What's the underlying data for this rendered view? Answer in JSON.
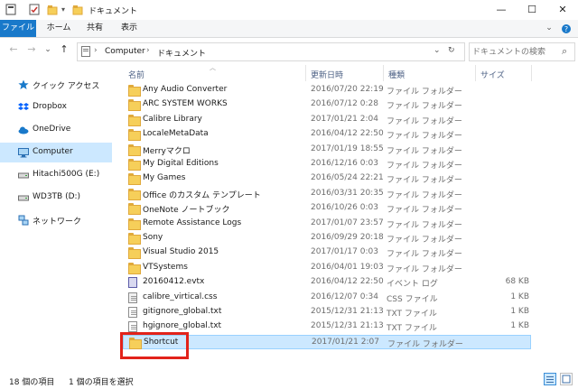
{
  "window": {
    "title": "ドキュメント",
    "minimize_glyph": "—",
    "maximize_glyph": "☐",
    "close_glyph": "✕"
  },
  "ribbon": {
    "tabs": [
      "ファイル",
      "ホーム",
      "共有",
      "表示"
    ],
    "accent": "#1979ca"
  },
  "address": {
    "back_glyph": "←",
    "forward_glyph": "→",
    "recent_glyph": "⌄",
    "up_glyph": "↑",
    "separator": "›",
    "crumbs": [
      "Computer",
      "ドキュメント"
    ],
    "dropdown_glyph": "⌄",
    "refresh_glyph": "↻"
  },
  "search": {
    "placeholder": "ドキュメントの検索",
    "icon_glyph": "⌕"
  },
  "nav": {
    "items": [
      {
        "label": "クイック アクセス",
        "icon": "star-icon"
      },
      {
        "label": "Dropbox",
        "icon": "dropbox-icon"
      },
      {
        "label": "OneDrive",
        "icon": "cloud-icon"
      },
      {
        "label": "Computer",
        "icon": "computer-icon",
        "selected": true
      },
      {
        "label": "Hitachi500G (E:)",
        "icon": "drive-icon"
      },
      {
        "label": "WD3TB (D:)",
        "icon": "drive-icon"
      },
      {
        "label": "ネットワーク",
        "icon": "network-icon"
      }
    ]
  },
  "columns": {
    "name": "名前",
    "date": "更新日時",
    "type": "種類",
    "size": "サイズ"
  },
  "files": [
    {
      "name": "Any Audio Converter",
      "date": "2016/07/20 22:19",
      "type": "ファイル フォルダー",
      "size": "",
      "icon": "folder-icon"
    },
    {
      "name": "ARC SYSTEM WORKS",
      "date": "2016/07/12 0:28",
      "type": "ファイル フォルダー",
      "size": "",
      "icon": "folder-icon"
    },
    {
      "name": "Calibre Library",
      "date": "2017/01/21 2:04",
      "type": "ファイル フォルダー",
      "size": "",
      "icon": "folder-icon"
    },
    {
      "name": "LocaleMetaData",
      "date": "2016/04/12 22:50",
      "type": "ファイル フォルダー",
      "size": "",
      "icon": "folder-icon"
    },
    {
      "name": "Merryマクロ",
      "date": "2017/01/19 18:55",
      "type": "ファイル フォルダー",
      "size": "",
      "icon": "folder-icon"
    },
    {
      "name": "My Digital Editions",
      "date": "2016/12/16 0:03",
      "type": "ファイル フォルダー",
      "size": "",
      "icon": "folder-icon"
    },
    {
      "name": "My Games",
      "date": "2016/05/24 22:21",
      "type": "ファイル フォルダー",
      "size": "",
      "icon": "folder-icon"
    },
    {
      "name": "Office のカスタム テンプレート",
      "date": "2016/03/31 20:35",
      "type": "ファイル フォルダー",
      "size": "",
      "icon": "folder-icon"
    },
    {
      "name": "OneNote ノートブック",
      "date": "2016/10/26 0:03",
      "type": "ファイル フォルダー",
      "size": "",
      "icon": "folder-icon"
    },
    {
      "name": "Remote Assistance Logs",
      "date": "2017/01/07 23:57",
      "type": "ファイル フォルダー",
      "size": "",
      "icon": "folder-icon"
    },
    {
      "name": "Sony",
      "date": "2016/09/29 20:18",
      "type": "ファイル フォルダー",
      "size": "",
      "icon": "folder-icon"
    },
    {
      "name": "Visual Studio 2015",
      "date": "2017/01/17 0:03",
      "type": "ファイル フォルダー",
      "size": "",
      "icon": "folder-icon"
    },
    {
      "name": "VTSystems",
      "date": "2016/04/01 19:03",
      "type": "ファイル フォルダー",
      "size": "",
      "icon": "folder-icon"
    },
    {
      "name": "20160412.evtx",
      "date": "2016/04/12 22:50",
      "type": "イベント ログ",
      "size": "68 KB",
      "icon": "event-log-icon"
    },
    {
      "name": "calibre_virtical.css",
      "date": "2016/12/07 0:34",
      "type": "CSS ファイル",
      "size": "1 KB",
      "icon": "css-file-icon"
    },
    {
      "name": "gitignore_global.txt",
      "date": "2015/12/31 21:13",
      "type": "TXT ファイル",
      "size": "1 KB",
      "icon": "text-file-icon"
    },
    {
      "name": "hgignore_global.txt",
      "date": "2015/12/31 21:13",
      "type": "TXT ファイル",
      "size": "1 KB",
      "icon": "text-file-icon"
    },
    {
      "name": "Shortcut",
      "date": "2017/01/21 2:07",
      "type": "ファイル フォルダー",
      "size": "",
      "icon": "folder-icon",
      "selected": true
    }
  ],
  "status": {
    "count": "18 個の項目",
    "selected": "1 個の項目を選択"
  },
  "colors": {
    "selection": "#cce8ff",
    "highlight_box": "#e2231a",
    "folder": "#f6cf5a"
  }
}
